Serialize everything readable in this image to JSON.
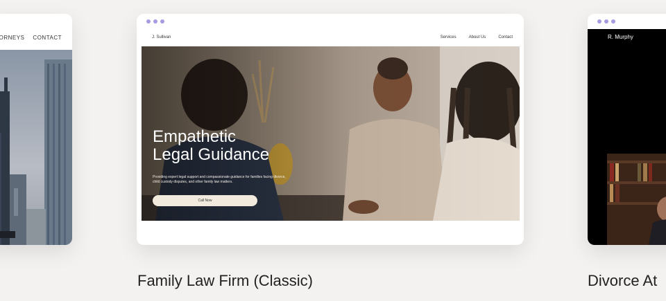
{
  "left_card": {
    "nav": [
      "TTORNEYS",
      "CONTACT"
    ]
  },
  "center_card": {
    "logo": "J. Sullivan",
    "nav": [
      "Services",
      "About Us",
      "Contact"
    ],
    "hero_title_line1": "Empathetic",
    "hero_title_line2": "Legal Guidance",
    "hero_text": "Providing expert legal support and compassionate guidance for families facing divorce, child custody disputes, and other family law matters.",
    "cta_label": "Call Now",
    "caption": "Family Law Firm (Classic)"
  },
  "right_card": {
    "logo": "R. Murphy",
    "caption": "Divorce At"
  },
  "colors": {
    "background": "#f4f2f0",
    "dots": "#a99be0"
  }
}
